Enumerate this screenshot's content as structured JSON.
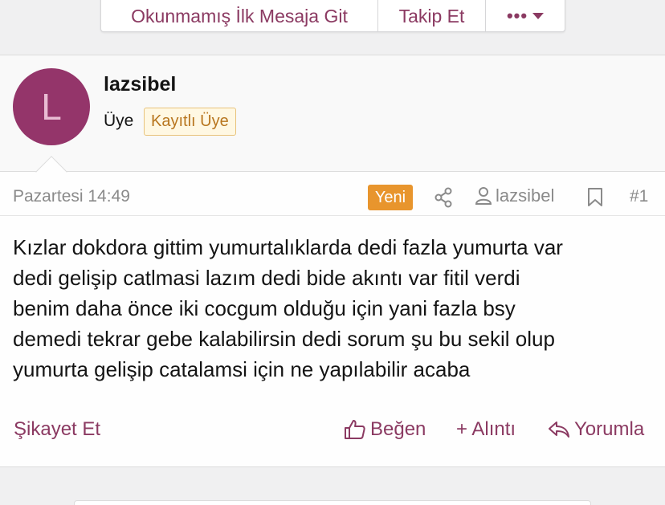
{
  "toolbar": {
    "unread_label": "Okunmamış İlk Mesaja Git",
    "follow_label": "Takip Et",
    "more_label": "•••"
  },
  "user": {
    "avatar_letter": "L",
    "avatar_color": "#94356a",
    "username": "lazsibel",
    "role": "Üye",
    "badge": "Kayıtlı Üye"
  },
  "meta": {
    "date": "Pazartesi 14:49",
    "new_badge": "Yeni",
    "author": "lazsibel",
    "post_number": "#1"
  },
  "post": {
    "lines": [
      "Kızlar dokdora gittim yumurtalıklarda dedi fazla yumurta var",
      "dedi gelişip catlmasi lazım dedi bide akıntı var fitil verdi",
      "benim daha önce iki cocgum olduğu için yani fazla bsy",
      "demedi tekrar gebe kalabilirsin dedi sorum şu bu sekil olup",
      "yumurta gelişip catalamsi için ne yapılabilir acaba"
    ]
  },
  "actions": {
    "report": "Şikayet Et",
    "like": "Beğen",
    "quote": "+ Alıntı",
    "reply": "Yorumla"
  },
  "colors": {
    "accent": "#8b3a62",
    "new_badge": "#e8952d",
    "member_badge_text": "#b8761f"
  }
}
